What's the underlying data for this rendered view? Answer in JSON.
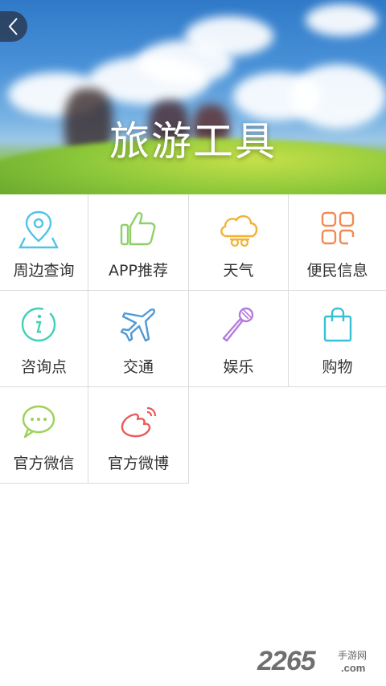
{
  "header": {
    "title": "旅游工具",
    "back_icon": "chevron-left-icon"
  },
  "tools": [
    {
      "label": "周边查询",
      "icon": "location-pin-icon",
      "color": "#4fc3e8"
    },
    {
      "label": "APP推荐",
      "icon": "thumbs-up-icon",
      "color": "#8fd06a"
    },
    {
      "label": "天气",
      "icon": "cloud-weather-icon",
      "color": "#f2b233"
    },
    {
      "label": "便民信息",
      "icon": "grid-apps-icon",
      "color": "#f08a55"
    },
    {
      "label": "咨询点",
      "icon": "info-icon",
      "color": "#3ed1b6"
    },
    {
      "label": "交通",
      "icon": "airplane-icon",
      "color": "#4f9ad6"
    },
    {
      "label": "娱乐",
      "icon": "microphone-icon",
      "color": "#b37be0"
    },
    {
      "label": "购物",
      "icon": "shopping-bag-icon",
      "color": "#36c1d6"
    },
    {
      "label": "官方微信",
      "icon": "wechat-icon",
      "color": "#9cd15a"
    },
    {
      "label": "官方微博",
      "icon": "weibo-icon",
      "color": "#ea5a5a"
    }
  ],
  "watermark": {
    "number": "2265",
    "top_text": "手游网",
    "bottom_text": ".com"
  }
}
